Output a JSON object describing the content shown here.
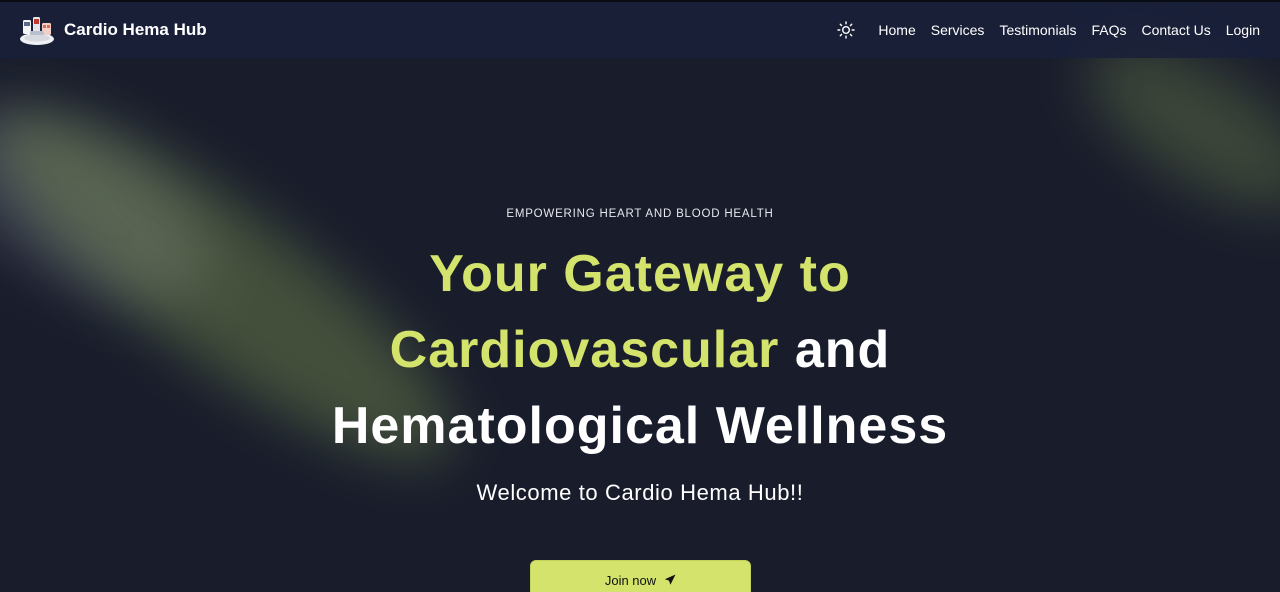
{
  "brand": {
    "name": "Cardio Hema Hub",
    "logo_icon": "medical-equipment-logo"
  },
  "nav": {
    "theme_icon": "sun-icon",
    "links": [
      "Home",
      "Services",
      "Testimonials",
      "FAQs",
      "Contact Us",
      "Login"
    ]
  },
  "hero": {
    "eyebrow": "EMPOWERING HEART AND BLOOD HEALTH",
    "headline_accent": "Your Gateway to Cardiovascular",
    "headline_rest": "and Hematological Wellness",
    "welcome": "Welcome to Cardio Hema Hub!!",
    "cta_label": "Join now",
    "cta_icon": "send-icon"
  },
  "colors": {
    "background": "#181c2b",
    "navbar": "#19203a",
    "accent": "#d4e36b",
    "text": "#ffffff"
  }
}
